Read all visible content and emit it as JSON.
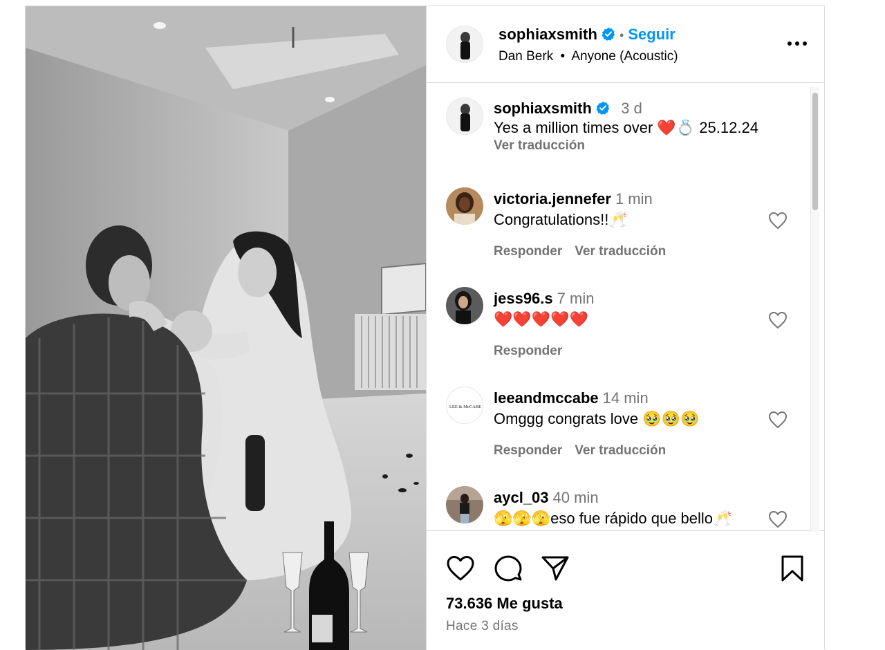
{
  "post": {
    "author": {
      "username": "sophiaxsmith",
      "follow_label": "Seguir",
      "separator": "•",
      "audio_artist": "Dan Berk",
      "audio_sep": "•",
      "audio_track": "Anyone (Acoustic)"
    },
    "caption": {
      "username": "sophiaxsmith",
      "time": "3 d",
      "text": "Yes a million times over ❤️💍 25.12.24",
      "translate_label": "Ver traducción"
    },
    "comments": [
      {
        "username": "victoria.jennefer",
        "time": "1 min",
        "text": "Congratulations!!🥂",
        "reply_label": "Responder",
        "translate_label": "Ver traducción"
      },
      {
        "username": "jess96.s",
        "time": "7 min",
        "text": "❤️❤️❤️❤️❤️",
        "reply_label": "Responder"
      },
      {
        "username": "leeandmccabe",
        "time": "14 min",
        "text": "Omggg congrats love 🥹🥹🥹",
        "reply_label": "Responder",
        "translate_label": "Ver traducción",
        "avatar_text": "LEE & McCABE"
      },
      {
        "username": "aycl_03",
        "time": "40 min",
        "text": "🫣🫣🫣eso fue rápido que bello🥂"
      }
    ],
    "likes": "73.636 Me gusta",
    "posted_ago": "Hace 3 días"
  },
  "colors": {
    "accent": "#0095f6",
    "secondary_text": "#737373",
    "border": "#dbdbdb"
  },
  "icons": {
    "verified": "verified-badge-icon",
    "more": "more-options-icon",
    "like": "heart-icon",
    "comment": "comment-bubble-icon",
    "share": "paper-plane-icon",
    "save": "bookmark-icon"
  }
}
